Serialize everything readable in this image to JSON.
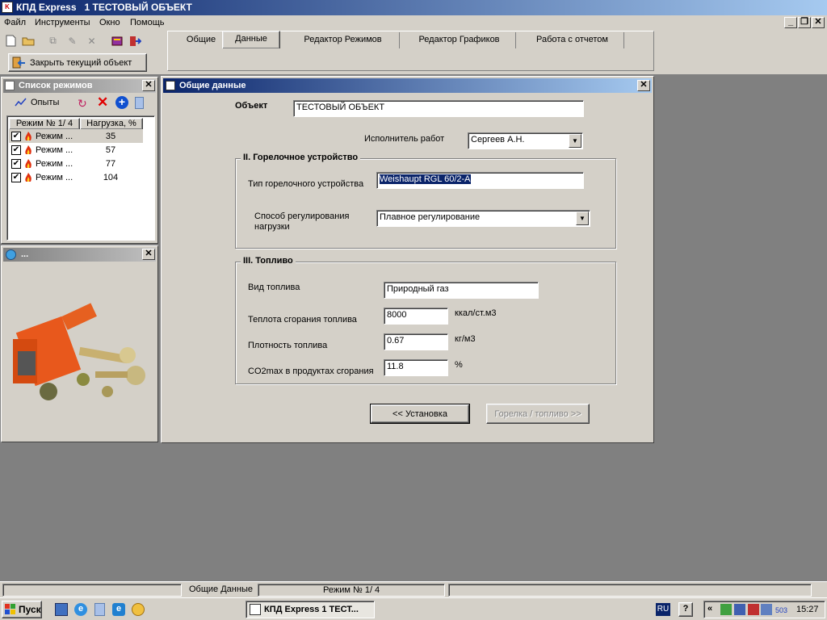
{
  "titlebar": {
    "app": "КПД Express",
    "doc": "1 ТЕСТОВЫЙ ОБЪЕКТ"
  },
  "menu": [
    "Файл",
    "Инструменты",
    "Окно",
    "Помощь"
  ],
  "toolbar": {
    "close_object": "Закрыть текущий объект"
  },
  "tabs": [
    "Общие",
    "Данные",
    "Редактор Режимов",
    "Редактор Графиков",
    "Работа с отчетом"
  ],
  "modes_panel": {
    "title": "Список режимов",
    "experiments": "Опыты",
    "col_mode": "Режим № 1/ 4",
    "col_load": "Нагрузка, %",
    "rows": [
      {
        "name": "Режим ...",
        "load": "35"
      },
      {
        "name": "Режим ...",
        "load": "57"
      },
      {
        "name": "Режим ...",
        "load": "77"
      },
      {
        "name": "Режим ...",
        "load": "104"
      }
    ]
  },
  "image_panel": {
    "title": "..."
  },
  "dialog": {
    "title": "Общие данные",
    "object_label": "Объект",
    "object_value": "ТЕСТОВЫЙ ОБЪЕКТ",
    "executor_label": "Исполнитель работ",
    "executor_value": "Сергеев А.Н.",
    "burner_group": "II. Горелочное устройство",
    "burner_type_label": "Тип горелочного устройства",
    "burner_type_value": "Weishaupt RGL 60/2-A",
    "regulation_label_1": "Способ регулирования",
    "regulation_label_2": "нагрузки",
    "regulation_value": "Плавное регулирование",
    "fuel_group": "III. Топливо",
    "fuel_type_label": "Вид топлива",
    "fuel_type_value": "Природный газ",
    "heat_label": "Теплота сгорания топлива",
    "heat_value": "8000",
    "heat_unit": "ккал/ст.м3",
    "density_label": "Плотность топлива",
    "density_value": "0.67",
    "density_unit": "кг/м3",
    "co2_label": "CO2max в продуктах сгорания",
    "co2_value": "11.8",
    "co2_unit": "%",
    "back_button": "<< Установка",
    "next_button": "Горелка / топливо >>"
  },
  "statusbar": {
    "left": "Общие Данные",
    "middle": "Режим № 1/ 4"
  },
  "taskbar": {
    "start": "Пуск",
    "task": "КПД Express 1 ТЕСТ...",
    "lang": "RU",
    "tray_num": "503",
    "clock": "15:27"
  },
  "colors": {
    "titlebar_start": "#0a246a",
    "titlebar_end": "#a6caf0",
    "face": "#d4d0c8",
    "desktop": "#808080",
    "selection": "#0a246a"
  }
}
